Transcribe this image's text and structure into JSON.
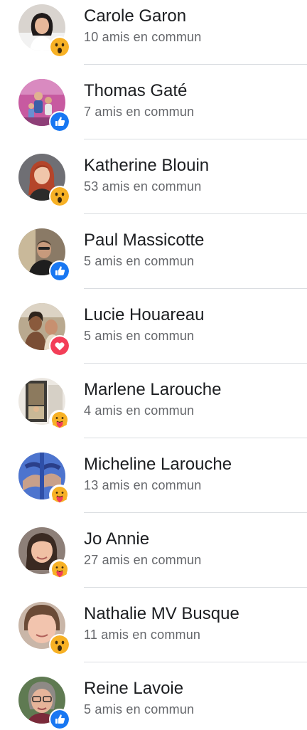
{
  "people": [
    {
      "name": "Carole Garon",
      "mutual": "10 amis en commun",
      "reaction": "wow"
    },
    {
      "name": "Thomas Gaté",
      "mutual": "7 amis en commun",
      "reaction": "like"
    },
    {
      "name": "Katherine Blouin",
      "mutual": "53 amis en commun",
      "reaction": "wow"
    },
    {
      "name": "Paul Massicotte",
      "mutual": "5 amis en commun",
      "reaction": "like"
    },
    {
      "name": "Lucie Houareau",
      "mutual": "5 amis en commun",
      "reaction": "love"
    },
    {
      "name": "Marlene Larouche",
      "mutual": "4 amis en commun",
      "reaction": "care"
    },
    {
      "name": "Micheline Larouche",
      "mutual": "13 amis en commun",
      "reaction": "care"
    },
    {
      "name": "Jo Annie",
      "mutual": "27 amis en commun",
      "reaction": "care"
    },
    {
      "name": "Nathalie MV Busque",
      "mutual": "11 amis en commun",
      "reaction": "wow"
    },
    {
      "name": "Reine Lavoie",
      "mutual": "5 amis en commun",
      "reaction": "like"
    }
  ],
  "colors": {
    "like": "#1877f2",
    "love": "#f33e58",
    "wow_face": "#f7b125",
    "care_face": "#f7b125"
  }
}
